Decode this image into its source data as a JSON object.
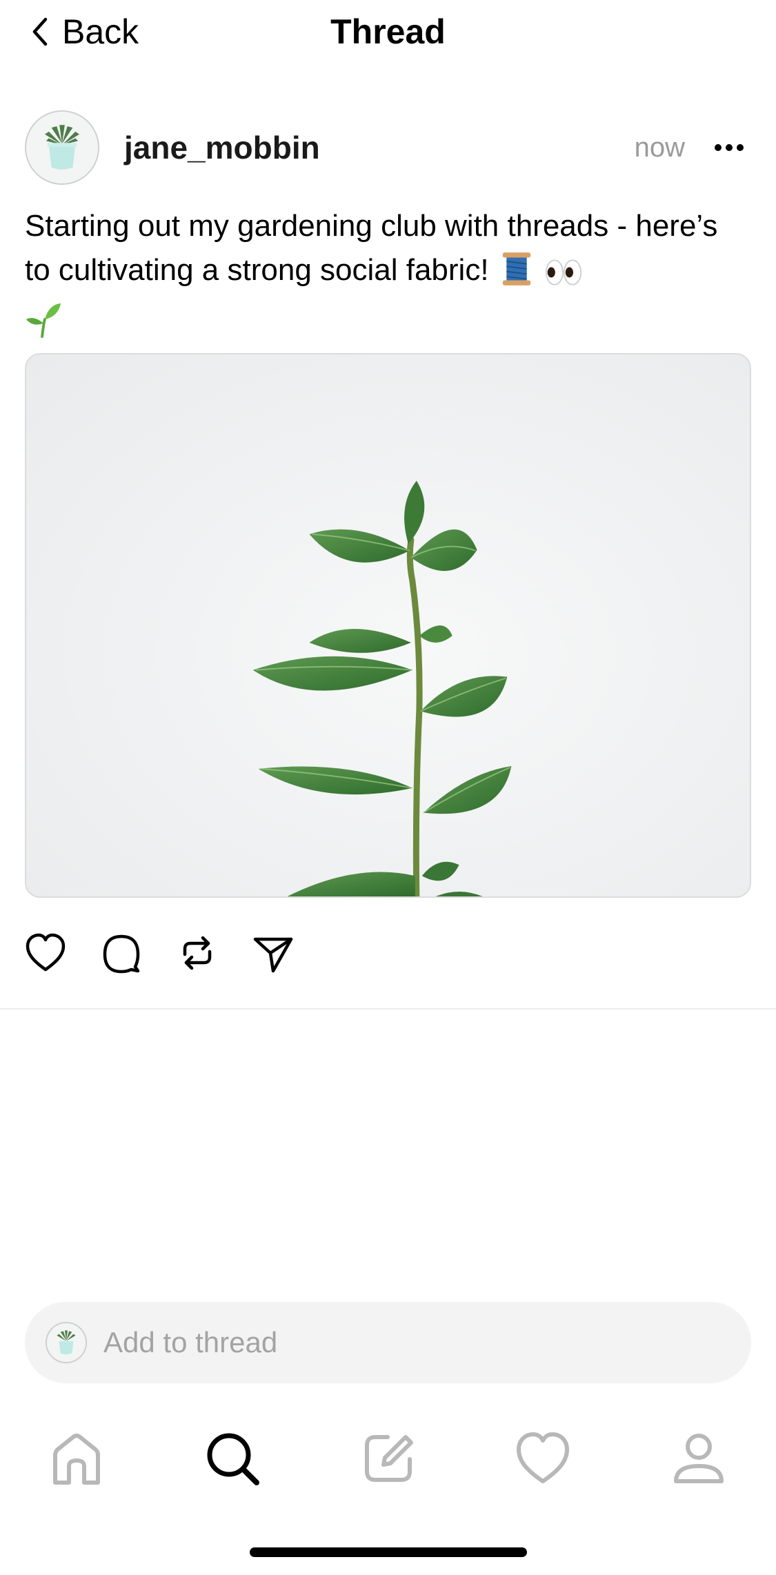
{
  "header": {
    "back_label": "Back",
    "title": "Thread"
  },
  "post": {
    "username": "jane_mobbin",
    "timestamp": "now",
    "text": "Starting out my gardening club with threads - here’s to cultivating a strong social fabric!",
    "emojis": [
      "🧵",
      "👀",
      "🌱"
    ]
  },
  "actions": [
    "heart-icon",
    "comment-icon",
    "repost-icon",
    "share-icon"
  ],
  "composer": {
    "placeholder": "Add to thread"
  },
  "bottom_nav": {
    "items": [
      "home-icon",
      "search-icon",
      "compose-icon",
      "activity-icon",
      "profile-icon"
    ],
    "active": "search-icon"
  },
  "colors": {
    "text": "#000000",
    "muted": "#9a9a9a",
    "inactive_icon": "#b8b8b8",
    "composer_bg": "#f3f3f3",
    "leaf_green": "#3e8a3a"
  }
}
